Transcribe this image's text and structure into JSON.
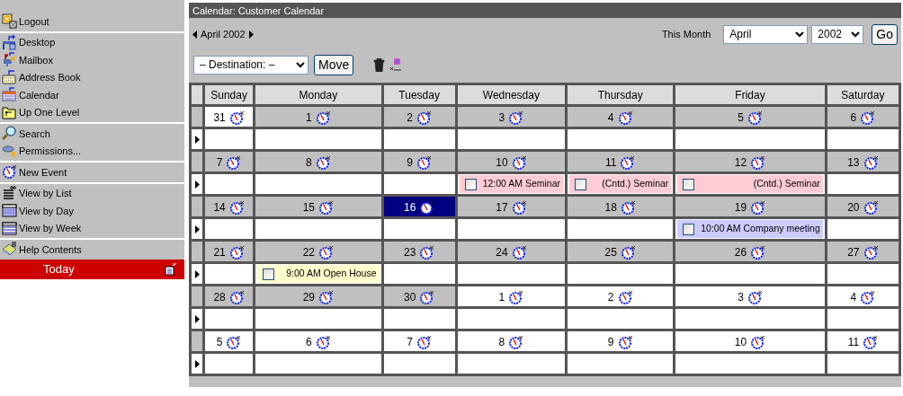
{
  "sidebar": {
    "groups": [
      [
        {
          "label": "Logout"
        }
      ],
      [
        {
          "label": "Desktop"
        },
        {
          "label": "Mailbox"
        },
        {
          "label": "Address Book"
        },
        {
          "label": "Calendar"
        },
        {
          "label": "Up One Level"
        }
      ],
      [
        {
          "label": "Search"
        },
        {
          "label": "Permissions..."
        }
      ],
      [
        {
          "label": "New Event"
        }
      ],
      [
        {
          "label": "View by List"
        },
        {
          "label": "View by Day"
        },
        {
          "label": "View by Week"
        }
      ],
      [
        {
          "label": "Help Contents"
        }
      ]
    ],
    "today": "Today"
  },
  "window": {
    "title": "Calendar: Customer Calendar"
  },
  "nav": {
    "period": "April 2002",
    "month_label": "This Month",
    "month": "April",
    "year": "2002",
    "go": "Go"
  },
  "toolbar": {
    "destination": "– Destination: –",
    "move": "Move"
  },
  "calendar": {
    "columns": [
      "Sunday",
      "Monday",
      "Tuesday",
      "Wednesday",
      "Thursday",
      "Friday",
      "Saturday"
    ],
    "weeks": [
      {
        "days": [
          {
            "date": "31",
            "in_month": false,
            "today": false
          },
          {
            "date": "1",
            "in_month": true,
            "today": false
          },
          {
            "date": "2",
            "in_month": true,
            "today": false
          },
          {
            "date": "3",
            "in_month": true,
            "today": false
          },
          {
            "date": "4",
            "in_month": true,
            "today": false
          },
          {
            "date": "5",
            "in_month": true,
            "today": false
          },
          {
            "date": "6",
            "in_month": true,
            "today": false
          }
        ]
      },
      {
        "days": [
          {
            "date": "7",
            "in_month": true,
            "today": false
          },
          {
            "date": "8",
            "in_month": true,
            "today": false
          },
          {
            "date": "9",
            "in_month": true,
            "today": false
          },
          {
            "date": "10",
            "in_month": true,
            "today": false,
            "events": [
              {
                "text": "12:00 AM Seminar",
                "color": "#ffccd5",
                "checked": false
              }
            ]
          },
          {
            "date": "11",
            "in_month": true,
            "today": false,
            "events": [
              {
                "text": "(Cntd.) Seminar",
                "color": "#ffccd5",
                "checked": false
              }
            ]
          },
          {
            "date": "12",
            "in_month": true,
            "today": false,
            "events": [
              {
                "text": "(Cntd.) Seminar",
                "color": "#ffccd5",
                "checked": false
              }
            ]
          },
          {
            "date": "13",
            "in_month": true,
            "today": false
          }
        ]
      },
      {
        "days": [
          {
            "date": "14",
            "in_month": true,
            "today": false
          },
          {
            "date": "15",
            "in_month": true,
            "today": false
          },
          {
            "date": "16",
            "in_month": true,
            "today": true
          },
          {
            "date": "17",
            "in_month": true,
            "today": false
          },
          {
            "date": "18",
            "in_month": true,
            "today": false
          },
          {
            "date": "19",
            "in_month": true,
            "today": false,
            "events": [
              {
                "text": "10:00 AM Company meeting",
                "color": "#ccccff",
                "checked": false
              }
            ]
          },
          {
            "date": "20",
            "in_month": true,
            "today": false
          }
        ]
      },
      {
        "days": [
          {
            "date": "21",
            "in_month": true,
            "today": false
          },
          {
            "date": "22",
            "in_month": true,
            "today": false,
            "events": [
              {
                "text": "9:00 AM Open House",
                "color": "#ffffcc",
                "checked": false
              }
            ]
          },
          {
            "date": "23",
            "in_month": true,
            "today": false
          },
          {
            "date": "24",
            "in_month": true,
            "today": false
          },
          {
            "date": "25",
            "in_month": true,
            "today": false
          },
          {
            "date": "26",
            "in_month": true,
            "today": false
          },
          {
            "date": "27",
            "in_month": true,
            "today": false
          }
        ]
      },
      {
        "days": [
          {
            "date": "28",
            "in_month": true,
            "today": false
          },
          {
            "date": "29",
            "in_month": true,
            "today": false
          },
          {
            "date": "30",
            "in_month": true,
            "today": false
          },
          {
            "date": "1",
            "in_month": false,
            "today": false
          },
          {
            "date": "2",
            "in_month": false,
            "today": false
          },
          {
            "date": "3",
            "in_month": false,
            "today": false
          },
          {
            "date": "4",
            "in_month": false,
            "today": false
          }
        ]
      },
      {
        "days": [
          {
            "date": "5",
            "in_month": false,
            "today": false
          },
          {
            "date": "6",
            "in_month": false,
            "today": false
          },
          {
            "date": "7",
            "in_month": false,
            "today": false
          },
          {
            "date": "8",
            "in_month": false,
            "today": false
          },
          {
            "date": "9",
            "in_month": false,
            "today": false
          },
          {
            "date": "10",
            "in_month": false,
            "today": false
          },
          {
            "date": "11",
            "in_month": false,
            "today": false
          }
        ]
      }
    ]
  }
}
